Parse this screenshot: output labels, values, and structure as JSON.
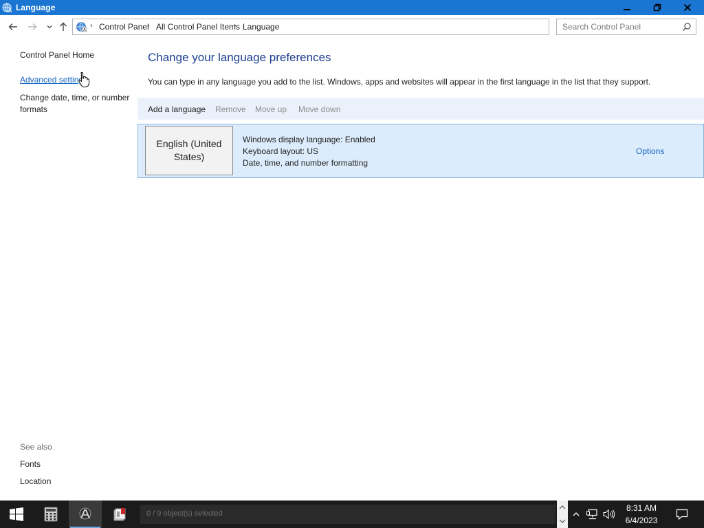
{
  "window": {
    "title": "Language",
    "minimize_icon": "minimize-icon",
    "restore_icon": "restore-icon",
    "close_icon": "close-icon"
  },
  "address": {
    "crumbs": [
      "Control Panel",
      "All Control Panel Items",
      "Language"
    ],
    "search_placeholder": "Search Control Panel"
  },
  "leftnav": {
    "home": "Control Panel Home",
    "advanced": "Advanced settings",
    "date_formats": "Change date, time, or number formats",
    "see_also": "See also",
    "fonts": "Fonts",
    "location": "Location"
  },
  "main": {
    "heading": "Change your language preferences",
    "description": "You can type in any language you add to the list. Windows, apps and websites will appear in the first language in the list that they support.",
    "toolbar": {
      "add": "Add a language",
      "remove": "Remove",
      "move_up": "Move up",
      "move_down": "Move down"
    },
    "languages": [
      {
        "name": "English (United States)",
        "details": [
          "Windows display language: Enabled",
          "Keyboard layout: US",
          "Date, time, and number formatting"
        ],
        "options": "Options"
      }
    ]
  },
  "taskbar": {
    "status": "0 / 9 object(s) selected",
    "time": "8:31 AM",
    "date": "6/4/2023",
    "accent": "#1a76d2"
  }
}
